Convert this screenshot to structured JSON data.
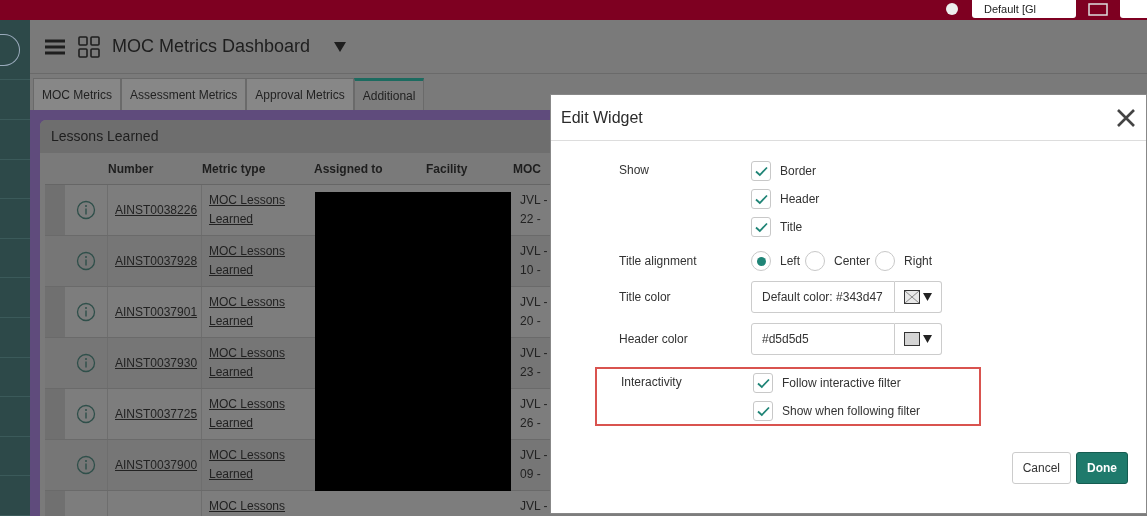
{
  "top_bar": {
    "scope_dropdown": "Default [Gl"
  },
  "dashboard": {
    "title": "MOC Metrics Dashboard"
  },
  "tabs": [
    {
      "label": "MOC Metrics",
      "selected": false
    },
    {
      "label": "Assessment Metrics",
      "selected": false
    },
    {
      "label": "Approval Metrics",
      "selected": false
    },
    {
      "label": "Additional",
      "selected": true
    }
  ],
  "widget": {
    "title": "Lessons Learned",
    "columns": [
      "Number",
      "Metric type",
      "Assigned to",
      "Facility",
      "MOC"
    ],
    "rows": [
      {
        "number": "AINST0038226",
        "metric_type": [
          "MOC Lessons",
          "Learned"
        ],
        "column_5": [
          "JVL -",
          "22 -"
        ]
      },
      {
        "number": "AINST0037928",
        "metric_type": [
          "MOC Lessons",
          "Learned"
        ],
        "column_5": [
          "JVL -",
          "10 -"
        ]
      },
      {
        "number": "AINST0037901",
        "metric_type": [
          "MOC Lessons",
          "Learned"
        ],
        "column_5": [
          "JVL -",
          "20 -"
        ]
      },
      {
        "number": "AINST0037930",
        "metric_type": [
          "MOC Lessons",
          "Learned"
        ],
        "column_5": [
          "JVL -",
          "23 -"
        ]
      },
      {
        "number": "AINST0037725",
        "metric_type": [
          "MOC Lessons",
          "Learned"
        ],
        "column_5": [
          "JVL -",
          "26 -"
        ]
      },
      {
        "number": "AINST0037900",
        "metric_type": [
          "MOC Lessons",
          "Learned"
        ],
        "column_5": [
          "JVL -",
          "09 -"
        ]
      },
      {
        "number": "",
        "metric_type": [
          "MOC Lessons"
        ],
        "column_5": [
          "JVL -"
        ]
      }
    ]
  },
  "dialog": {
    "title": "Edit Widget",
    "show": {
      "label": "Show",
      "options": [
        {
          "label": "Border",
          "checked": true
        },
        {
          "label": "Header",
          "checked": true
        },
        {
          "label": "Title",
          "checked": true
        }
      ]
    },
    "title_alignment": {
      "label": "Title alignment",
      "options": [
        {
          "label": "Left",
          "selected": true
        },
        {
          "label": "Center",
          "selected": false
        },
        {
          "label": "Right",
          "selected": false
        }
      ]
    },
    "title_color": {
      "label": "Title color",
      "value": "Default color: #343d47"
    },
    "header_color": {
      "label": "Header color",
      "value": "#d5d5d5"
    },
    "interactivity": {
      "label": "Interactivity",
      "highlighted": true,
      "options": [
        {
          "label": "Follow interactive filter",
          "checked": true
        },
        {
          "label": "Show when following filter",
          "checked": true
        }
      ]
    },
    "buttons": [
      {
        "label": "Cancel",
        "kind": "secondary"
      },
      {
        "label": "Done",
        "kind": "primary"
      }
    ]
  }
}
